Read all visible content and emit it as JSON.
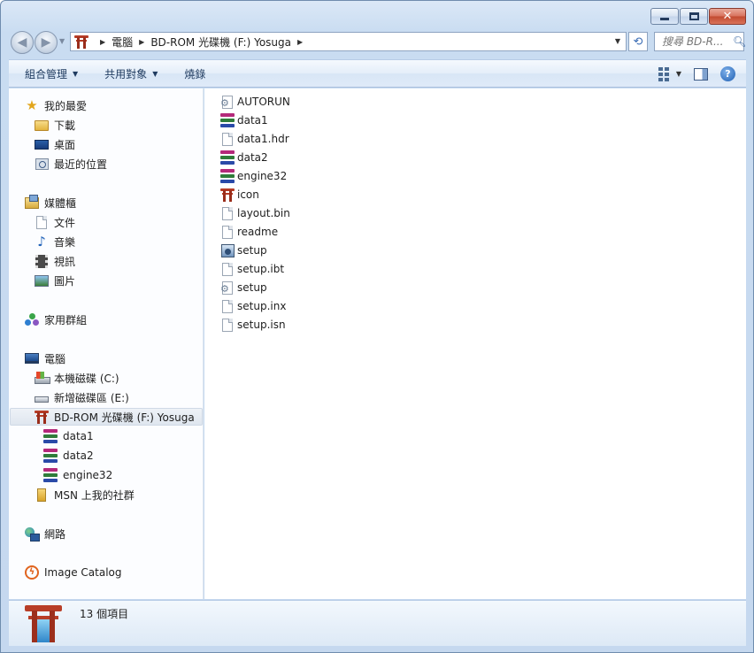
{
  "window": {
    "address": {
      "crumbs": [
        "電腦",
        "BD-ROM 光碟機 (F:) Yosuga"
      ]
    },
    "search": {
      "placeholder": "搜尋 BD-R..."
    }
  },
  "toolbar": {
    "organize": "組合管理",
    "share": "共用對象",
    "burn": "燒錄"
  },
  "nav": {
    "favorites": {
      "title": "我的最愛",
      "items": [
        {
          "label": "下載",
          "icon": "download-folder-icon"
        },
        {
          "label": "桌面",
          "icon": "desktop-icon"
        },
        {
          "label": "最近的位置",
          "icon": "recent-places-icon"
        }
      ]
    },
    "libraries": {
      "title": "媒體櫃",
      "items": [
        {
          "label": "文件",
          "icon": "documents-icon"
        },
        {
          "label": "音樂",
          "icon": "music-icon"
        },
        {
          "label": "視訊",
          "icon": "video-icon"
        },
        {
          "label": "圖片",
          "icon": "pictures-icon"
        }
      ]
    },
    "homegroup": {
      "title": "家用群組"
    },
    "computer": {
      "title": "電腦",
      "items": [
        {
          "label": "本機磁碟 (C:)",
          "icon": "local-disk-icon"
        },
        {
          "label": "新增磁碟區 (E:)",
          "icon": "volume-icon"
        },
        {
          "label": "BD-ROM 光碟機 (F:) Yosuga",
          "icon": "bd-rom-icon",
          "selected": true
        },
        {
          "label": "data1",
          "icon": "winrar-archive-icon"
        },
        {
          "label": "data2",
          "icon": "winrar-archive-icon"
        },
        {
          "label": "engine32",
          "icon": "winrar-archive-icon"
        },
        {
          "label": "MSN 上我的社群",
          "icon": "msn-folder-icon"
        }
      ]
    },
    "network": {
      "title": "網路"
    },
    "catalog": {
      "title": "Image Catalog"
    }
  },
  "files": [
    {
      "name": "AUTORUN",
      "icon": "settings-file-icon"
    },
    {
      "name": "data1",
      "icon": "winrar-archive-icon"
    },
    {
      "name": "data1.hdr",
      "icon": "blank-file-icon"
    },
    {
      "name": "data2",
      "icon": "winrar-archive-icon"
    },
    {
      "name": "engine32",
      "icon": "winrar-archive-icon"
    },
    {
      "name": "icon",
      "icon": "torii-icon"
    },
    {
      "name": "layout.bin",
      "icon": "blank-file-icon"
    },
    {
      "name": "readme",
      "icon": "blank-file-icon"
    },
    {
      "name": "setup",
      "icon": "setup-icon"
    },
    {
      "name": "setup.ibt",
      "icon": "blank-file-icon"
    },
    {
      "name": "setup",
      "icon": "settings-file-icon"
    },
    {
      "name": "setup.inx",
      "icon": "blank-file-icon"
    },
    {
      "name": "setup.isn",
      "icon": "blank-file-icon"
    }
  ],
  "status": {
    "item_count": "13 個項目"
  }
}
